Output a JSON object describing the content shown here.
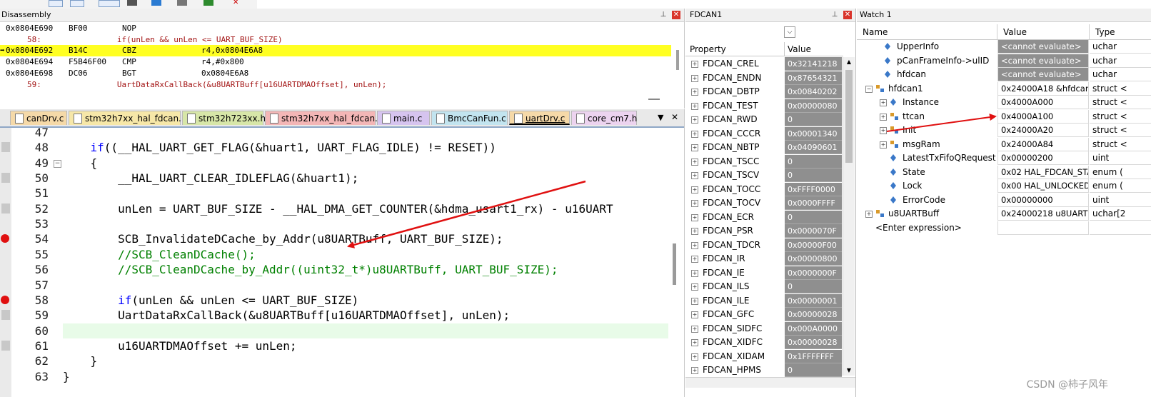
{
  "colors": {
    "arrow": "#e01010",
    "current_line": "#ffff22",
    "keyword": "#0000ff",
    "comment": "#008000"
  },
  "disassembly": {
    "title": "Disassembly",
    "rows": [
      {
        "addr": "0x0804E690",
        "op": "BF00",
        "mnem": "NOP",
        "arg": "",
        "src": ""
      },
      {
        "addr": "",
        "op": "",
        "mnem": "",
        "arg": "",
        "src": "58:                if(unLen && unLen <= UART_BUF_SIZE)"
      },
      {
        "addr": "0x0804E692",
        "op": "B14C",
        "mnem": "CBZ",
        "arg": "r4,0x0804E6A8",
        "src": "",
        "current": true
      },
      {
        "addr": "0x0804E694",
        "op": "F5B46F00",
        "mnem": "CMP",
        "arg": "r4,#0x800",
        "src": ""
      },
      {
        "addr": "0x0804E698",
        "op": "DC06",
        "mnem": "BGT",
        "arg": "0x0804E6A8",
        "src": ""
      },
      {
        "addr": "",
        "op": "",
        "mnem": "",
        "arg": "",
        "src": "59:                UartDataRxCallBack(&u8UARTBuff[u16UARTDMAOffset], unLen);"
      }
    ]
  },
  "editor": {
    "tabs": [
      {
        "label": "canDrv.c",
        "color": "#f5d9a8"
      },
      {
        "label": "stm32h7xx_hal_fdcan.h",
        "color": "#f6e7a8"
      },
      {
        "label": "stm32h723xx.h",
        "color": "#d7e6a8"
      },
      {
        "label": "stm32h7xx_hal_fdcan.c",
        "color": "#f3b6b6"
      },
      {
        "label": "main.c",
        "color": "#d6c4ef"
      },
      {
        "label": "BmcCanFun.c",
        "color": "#c2e4ef"
      },
      {
        "label": "uartDrv.c",
        "color": "#f5d9a8",
        "active": true
      },
      {
        "label": "core_cm7.h",
        "color": "#ecd3ef"
      }
    ],
    "lines": [
      {
        "n": "47",
        "code": "",
        "type": "plain"
      },
      {
        "n": "48",
        "code": "    if((__HAL_UART_GET_FLAG(&huart1, UART_FLAG_IDLE) != RESET))",
        "type": "if",
        "mark": "grey"
      },
      {
        "n": "49",
        "code": "    {",
        "type": "plain",
        "fold": true
      },
      {
        "n": "50",
        "code": "        __HAL_UART_CLEAR_IDLEFLAG(&huart1);",
        "type": "plain",
        "mark": "grey"
      },
      {
        "n": "51",
        "code": "",
        "type": "plain"
      },
      {
        "n": "52",
        "code": "        unLen = UART_BUF_SIZE - __HAL_DMA_GET_COUNTER(&hdma_usart1_rx) - u16UART",
        "type": "plain",
        "mark": "grey"
      },
      {
        "n": "53",
        "code": "",
        "type": "plain"
      },
      {
        "n": "54",
        "code": "        SCB_InvalidateDCache_by_Addr(u8UARTBuff, UART_BUF_SIZE);",
        "type": "plain",
        "mark": "bp"
      },
      {
        "n": "55",
        "code": "        //SCB_CleanDCache();",
        "type": "comment"
      },
      {
        "n": "56",
        "code": "        //SCB_CleanDCache_by_Addr((uint32_t*)u8UARTBuff, UART_BUF_SIZE);",
        "type": "comment"
      },
      {
        "n": "57",
        "code": "",
        "type": "plain"
      },
      {
        "n": "58",
        "code": "        if(unLen && unLen <= UART_BUF_SIZE)",
        "type": "if",
        "mark": "bp"
      },
      {
        "n": "59",
        "code": "        UartDataRxCallBack(&u8UARTBuff[u16UARTDMAOffset], unLen);",
        "type": "plain",
        "mark": "grey"
      },
      {
        "n": "60",
        "code": "",
        "type": "plain",
        "highlight": true
      },
      {
        "n": "61",
        "code": "        u16UARTDMAOffset += unLen;",
        "type": "plain",
        "mark": "grey"
      },
      {
        "n": "62",
        "code": "    }",
        "type": "plain"
      },
      {
        "n": "63",
        "code": "}",
        "type": "plain"
      }
    ]
  },
  "fdcan": {
    "title": "FDCAN1",
    "headers": {
      "property": "Property",
      "value": "Value"
    },
    "rows": [
      {
        "name": "FDCAN_CREL",
        "value": "0x32141218"
      },
      {
        "name": "FDCAN_ENDN",
        "value": "0x87654321"
      },
      {
        "name": "FDCAN_DBTP",
        "value": "0x00840202"
      },
      {
        "name": "FDCAN_TEST",
        "value": "0x00000080"
      },
      {
        "name": "FDCAN_RWD",
        "value": "0"
      },
      {
        "name": "FDCAN_CCCR",
        "value": "0x00001340"
      },
      {
        "name": "FDCAN_NBTP",
        "value": "0x04090601"
      },
      {
        "name": "FDCAN_TSCC",
        "value": "0"
      },
      {
        "name": "FDCAN_TSCV",
        "value": "0"
      },
      {
        "name": "FDCAN_TOCC",
        "value": "0xFFFF0000"
      },
      {
        "name": "FDCAN_TOCV",
        "value": "0x0000FFFF"
      },
      {
        "name": "FDCAN_ECR",
        "value": "0"
      },
      {
        "name": "FDCAN_PSR",
        "value": "0x0000070F"
      },
      {
        "name": "FDCAN_TDCR",
        "value": "0x00000F00"
      },
      {
        "name": "FDCAN_IR",
        "value": "0x00000800"
      },
      {
        "name": "FDCAN_IE",
        "value": "0x0000000F"
      },
      {
        "name": "FDCAN_ILS",
        "value": "0"
      },
      {
        "name": "FDCAN_ILE",
        "value": "0x00000001"
      },
      {
        "name": "FDCAN_GFC",
        "value": "0x00000028"
      },
      {
        "name": "FDCAN_SIDFC",
        "value": "0x000A0000"
      },
      {
        "name": "FDCAN_XIDFC",
        "value": "0x00000028"
      },
      {
        "name": "FDCAN_XIDAM",
        "value": "0x1FFFFFFF"
      },
      {
        "name": "FDCAN_HPMS",
        "value": "0"
      }
    ]
  },
  "watch": {
    "title": "Watch 1",
    "headers": {
      "name": "Name",
      "value": "Value",
      "type": "Type"
    },
    "rows": [
      {
        "name": "UpperInfo",
        "value": "<cannot evaluate>",
        "type": "uchar",
        "indent": 1,
        "dark": true,
        "icon": "var-icon"
      },
      {
        "name": "pCanFrameInfo->ulID",
        "value": "<cannot evaluate>",
        "type": "uchar",
        "indent": 1,
        "dark": true,
        "icon": "var-icon"
      },
      {
        "name": "hfdcan",
        "value": "<cannot evaluate>",
        "type": "uchar",
        "indent": 1,
        "dark": true,
        "icon": "var-icon"
      },
      {
        "name": "hfdcan1",
        "value": "0x24000A18 &hfdcan1",
        "type": "struct <",
        "indent": 0,
        "exp": "−",
        "icon": "struct-icon"
      },
      {
        "name": "Instance",
        "value": "0x4000A000",
        "type": "struct <",
        "indent": 2,
        "exp": "+",
        "icon": "var-icon"
      },
      {
        "name": "ttcan",
        "value": "0x4000A100",
        "type": "struct <",
        "indent": 2,
        "exp": "+",
        "icon": "struct-icon"
      },
      {
        "name": "Init",
        "value": "0x24000A20",
        "type": "struct <",
        "indent": 2,
        "exp": "+",
        "icon": "struct-icon"
      },
      {
        "name": "msgRam",
        "value": "0x24000A84",
        "type": "struct <",
        "indent": 2,
        "exp": "+",
        "icon": "struct-icon"
      },
      {
        "name": "LatestTxFifoQRequest",
        "value": "0x00000200",
        "type": "uint",
        "indent": 2,
        "icon": "var-icon"
      },
      {
        "name": "State",
        "value": "0x02 HAL_FDCAN_STA...",
        "type": "enum (",
        "indent": 2,
        "icon": "var-icon"
      },
      {
        "name": "Lock",
        "value": "0x00 HAL_UNLOCKED",
        "type": "enum (",
        "indent": 2,
        "icon": "var-icon"
      },
      {
        "name": "ErrorCode",
        "value": "0x00000000",
        "type": "uint",
        "indent": 2,
        "icon": "var-icon"
      },
      {
        "name": "u8UARTBuff",
        "value": "0x24000218 u8UARTBu...",
        "type": "uchar[2",
        "indent": 0,
        "exp": "+",
        "icon": "struct-icon"
      },
      {
        "name": "<Enter expression>",
        "value": "",
        "type": "",
        "indent": 0,
        "enter": true
      }
    ]
  },
  "watermark": "CSDN @柿子风年"
}
